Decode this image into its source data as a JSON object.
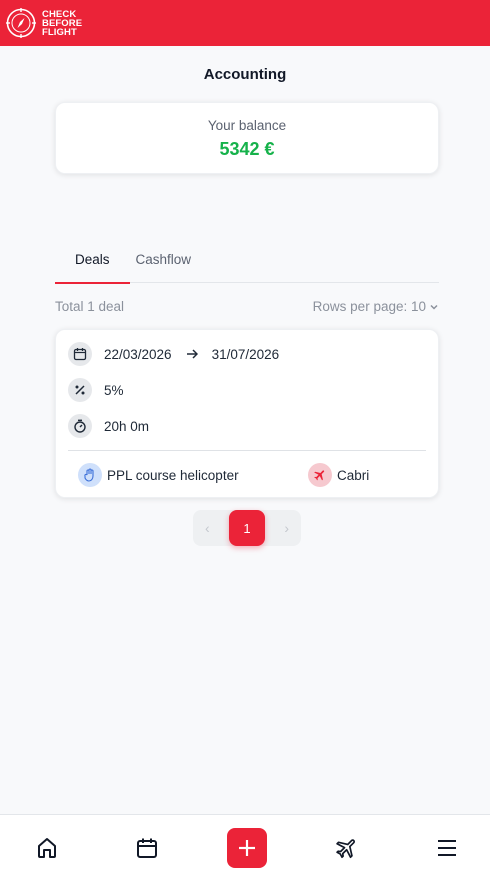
{
  "header": {
    "logo_lines": [
      "CHECK",
      "BEFORE",
      "FLIGHT"
    ]
  },
  "page": {
    "title": "Accounting"
  },
  "balance": {
    "label": "Your balance",
    "value": "5342 €",
    "value_color": "#16b24b"
  },
  "tabs": [
    {
      "label": "Deals",
      "active": true
    },
    {
      "label": "Cashflow",
      "active": false
    }
  ],
  "list_meta": {
    "total": "Total 1 deal",
    "rows_per_page": "Rows per page: 10"
  },
  "deal": {
    "start_date": "22/03/2026",
    "end_date": "31/07/2026",
    "percentage": "5%",
    "duration": "20h 0m",
    "course": "PPL course helicopter",
    "aircraft": "Cabri"
  },
  "pagination": {
    "current_page": "1"
  },
  "icons": {
    "calendar": "calendar-icon",
    "percent": "percent-icon",
    "timer": "stopwatch-icon",
    "arrow": "arrow-right-icon",
    "course": "hand-icon",
    "aircraft": "airplane-icon",
    "nav": [
      "home-icon",
      "calendar-icon",
      "plus-icon",
      "airplane-icon",
      "menu-icon"
    ]
  },
  "colors": {
    "brand": "#eb2338",
    "background": "#f8f9fb"
  }
}
